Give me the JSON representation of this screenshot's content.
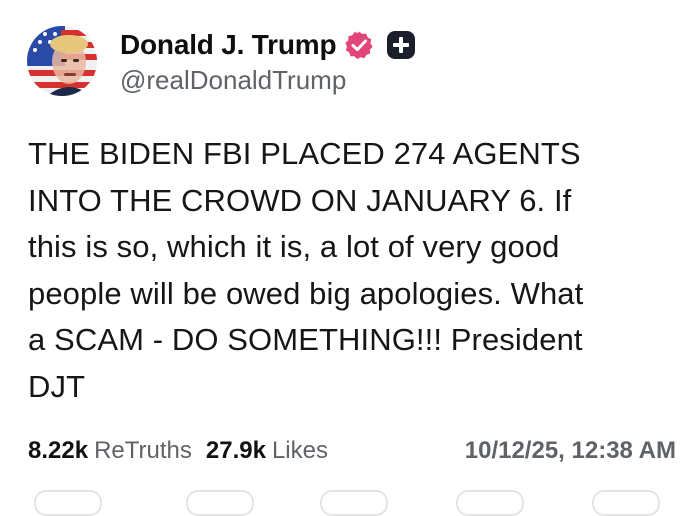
{
  "post": {
    "author": {
      "display_name": "Donald J. Trump",
      "handle": "@realDonaldTrump",
      "verified_badge_color": "#e0457b"
    },
    "text": "THE BIDEN FBI PLACED 274 AGENTS\nINTO THE CROWD ON JANUARY 6. If\nthis is so, which it is, a lot of very good\npeople will be owed big apologies. What\na SCAM - DO SOMETHING!!! President\nDJT",
    "stats": {
      "retruths_count": "8.22k",
      "retruths_label": "ReTruths",
      "likes_count": "27.9k",
      "likes_label": "Likes"
    },
    "timestamp": "10/12/25, 12:38 AM"
  },
  "icons": {
    "verified": "verified-badge-icon",
    "plus": "plus-badge-icon"
  }
}
